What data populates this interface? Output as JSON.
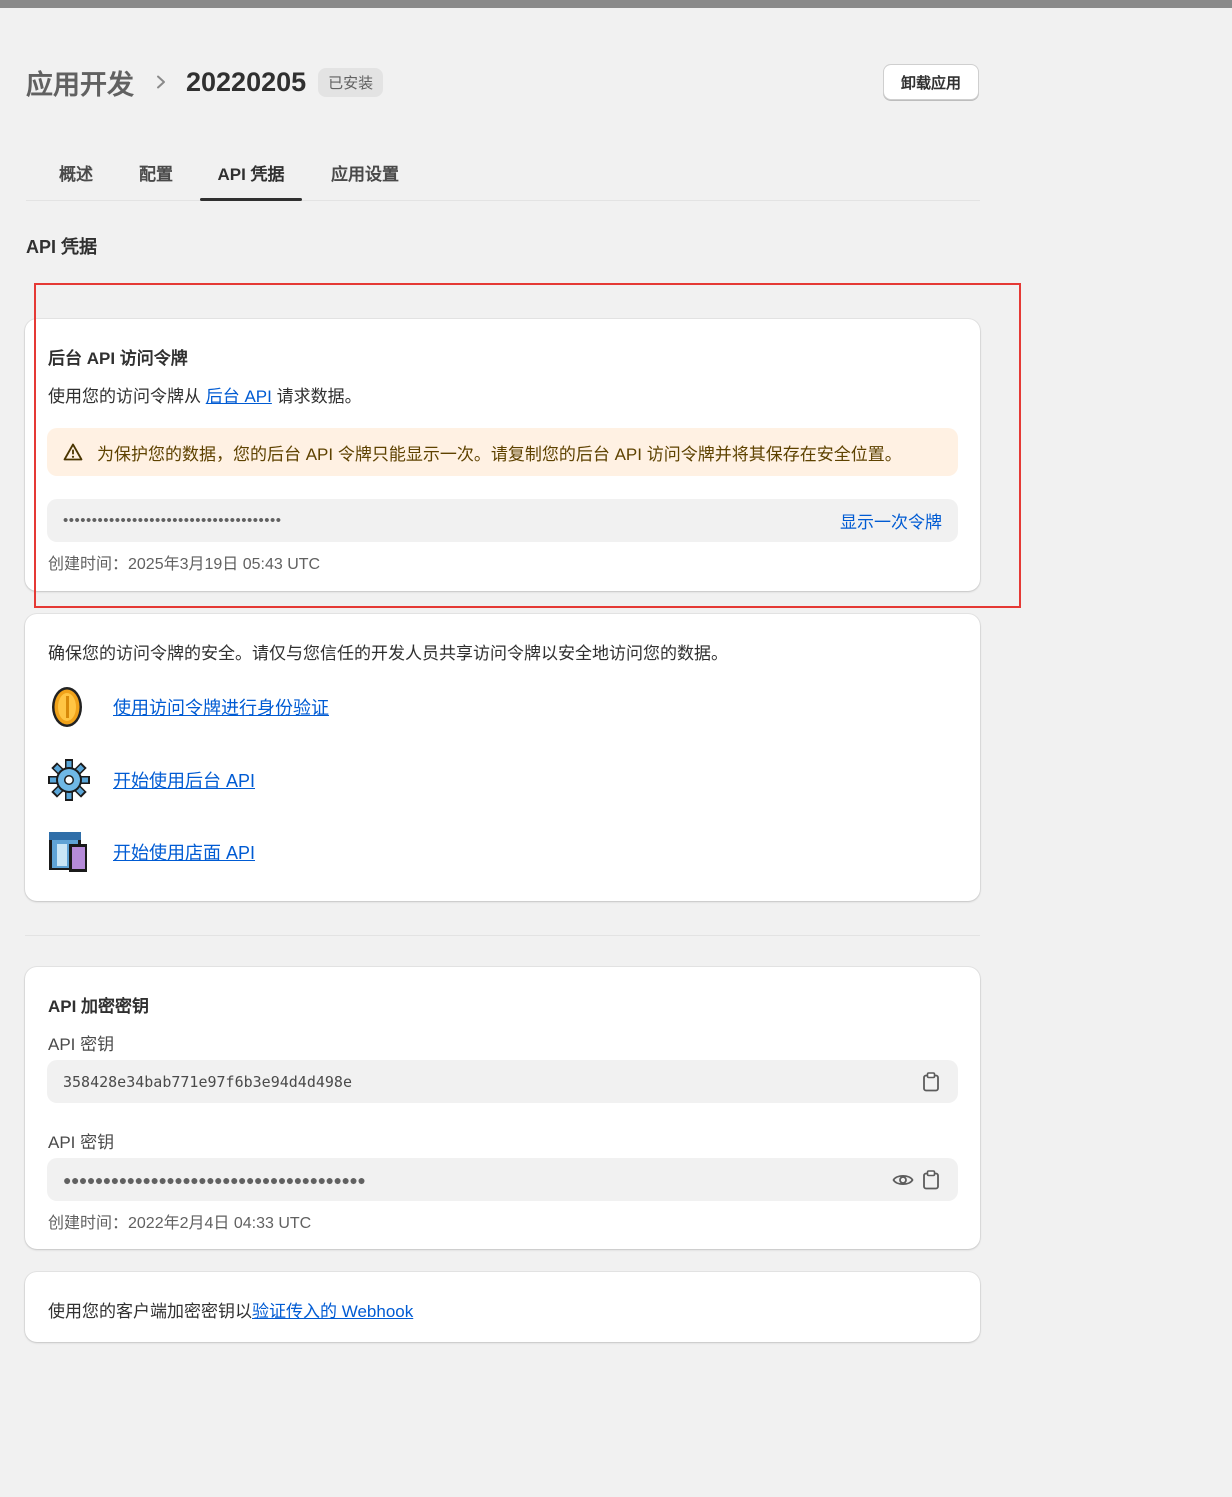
{
  "header": {
    "breadcrumb_parent": "应用开发",
    "app_name": "20220205",
    "status_badge": "已安装",
    "uninstall_label": "卸载应用"
  },
  "tabs": [
    {
      "label": "概述",
      "active": false
    },
    {
      "label": "配置",
      "active": false
    },
    {
      "label": "API 凭据",
      "active": true
    },
    {
      "label": "应用设置",
      "active": false
    }
  ],
  "section_title": "API 凭据",
  "admin_token_card": {
    "title": "后台 API 访问令牌",
    "desc_prefix": "使用您的访问令牌从 ",
    "desc_link": "后台 API",
    "desc_suffix": " 请求数据。",
    "warning": "为保护您的数据，您的后台 API 令牌只能显示一次。请复制您的后台 API 访问令牌并将其保存在安全位置。",
    "token_masked": "••••••••••••••••••••••••••••••••••••••",
    "reveal_label": "显示一次令牌",
    "created": "创建时间：2025年3月19日 05:43 UTC"
  },
  "resources_card": {
    "text": "确保您的访问令牌的安全。请仅与您信任的开发人员共享访问令牌以安全地访问您的数据。",
    "links": [
      {
        "label": "使用访问令牌进行身份验证",
        "icon": "coin-icon"
      },
      {
        "label": "开始使用后台 API",
        "icon": "gear-icon"
      },
      {
        "label": "开始使用店面 API",
        "icon": "storefront-icon"
      }
    ]
  },
  "api_keys_card": {
    "title": "API 加密密钥",
    "api_key_label": "API 密钥",
    "api_key_value": "358428e34bab771e97f6b3e94d4d498e",
    "secret_label": "API 密钥",
    "secret_masked": "●●●●●●●●●●●●●●●●●●●●●●●●●●●●●●●●●●●●●●",
    "created": "创建时间：2022年2月4日 04:33 UTC"
  },
  "webhook_card": {
    "prefix": "使用您的客户端加密密钥以",
    "link": "验证传入的 Webhook"
  },
  "colors": {
    "link": "#005bd3",
    "warning_bg": "#fff1e3",
    "highlight_border": "#e53935"
  }
}
